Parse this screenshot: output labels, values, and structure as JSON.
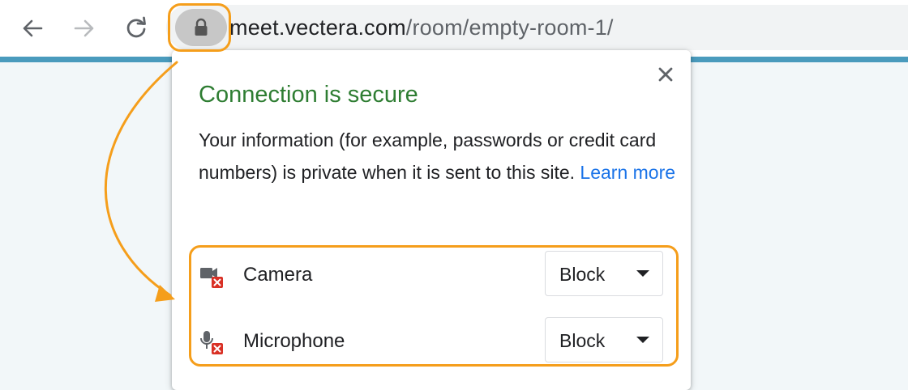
{
  "browser": {
    "url_host": "meet.vectera.com",
    "url_path": "/room/empty-room-1/"
  },
  "icons": {
    "back": "arrow-left-icon",
    "forward": "arrow-right-icon",
    "reload": "reload-icon",
    "lock": "lock-icon",
    "close": "close-icon",
    "camera": "camera-blocked-icon",
    "microphone": "microphone-blocked-icon"
  },
  "popup": {
    "title": "Connection is secure",
    "description": "Your information (for example, passwords or credit card numbers) is private when it is sent to this site.",
    "learn_more": "Learn more",
    "permissions": [
      {
        "label": "Camera",
        "value": "Block"
      },
      {
        "label": "Microphone",
        "value": "Block"
      }
    ]
  },
  "colors": {
    "secure_green": "#2e7d32",
    "link_blue": "#1a73e8",
    "annotation_orange": "#f59e1b",
    "blocked_red": "#d93025",
    "accent_line": "#4a9bbd"
  }
}
